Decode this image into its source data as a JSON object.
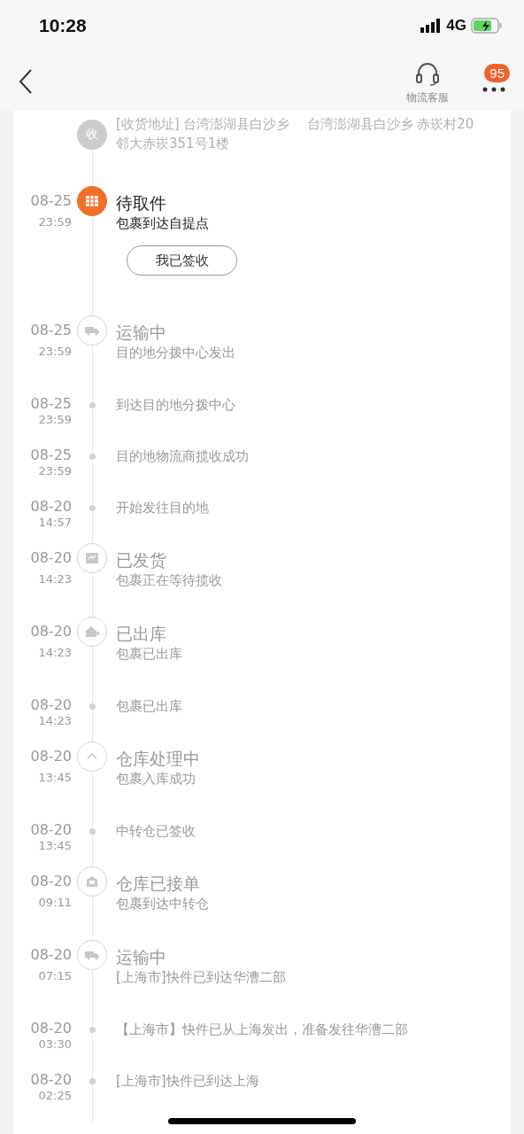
{
  "status_bar": {
    "time": "10:28",
    "network": "4G"
  },
  "header": {
    "support_label": "物流客服",
    "badge": "95"
  },
  "address": {
    "icon_text": "收",
    "text": "[收货地址] 台湾澎湖县白沙乡    台湾澎湖县白沙乡 赤崁村20邻大赤崁351号1楼"
  },
  "events": [
    {
      "kind": "major",
      "active": true,
      "date": "08-25",
      "time": "23:59",
      "title": "待取件",
      "detail": "包裹到达自提点",
      "button": "我已签收"
    },
    {
      "kind": "major",
      "active": false,
      "date": "08-25",
      "time": "23:59",
      "title": "运输中",
      "detail": "目的地分拨中心发出"
    },
    {
      "kind": "minor",
      "date": "08-25",
      "time": "23:59",
      "detail": "到达目的地分拨中心"
    },
    {
      "kind": "minor",
      "date": "08-25",
      "time": "23:59",
      "detail": "目的地物流商揽收成功"
    },
    {
      "kind": "minor",
      "date": "08-20",
      "time": "14:57",
      "detail": "开始发往目的地"
    },
    {
      "kind": "major",
      "active": false,
      "date": "08-20",
      "time": "14:23",
      "title": "已发货",
      "detail": "包裹正在等待揽收"
    },
    {
      "kind": "major",
      "active": false,
      "date": "08-20",
      "time": "14:23",
      "title": "已出库",
      "detail": "包裹已出库"
    },
    {
      "kind": "minor",
      "date": "08-20",
      "time": "14:23",
      "detail": "包裹已出库"
    },
    {
      "kind": "major",
      "active": false,
      "date": "08-20",
      "time": "13:45",
      "title": "仓库处理中",
      "detail": "包裹入库成功"
    },
    {
      "kind": "minor",
      "date": "08-20",
      "time": "13:45",
      "detail": "中转仓已签收"
    },
    {
      "kind": "major",
      "active": false,
      "date": "08-20",
      "time": "09:11",
      "title": "仓库已接单",
      "detail": "包裹到达中转仓"
    },
    {
      "kind": "major",
      "active": false,
      "date": "08-20",
      "time": "07:15",
      "title": "运输中",
      "detail": "[上海市]快件已到达华漕二部"
    },
    {
      "kind": "minor",
      "date": "08-20",
      "time": "03:30",
      "detail": "【上海市】快件已从上海发出，准备发往华漕二部"
    },
    {
      "kind": "minor",
      "date": "08-20",
      "time": "02:25",
      "detail": "[上海市]快件已到达上海"
    }
  ]
}
